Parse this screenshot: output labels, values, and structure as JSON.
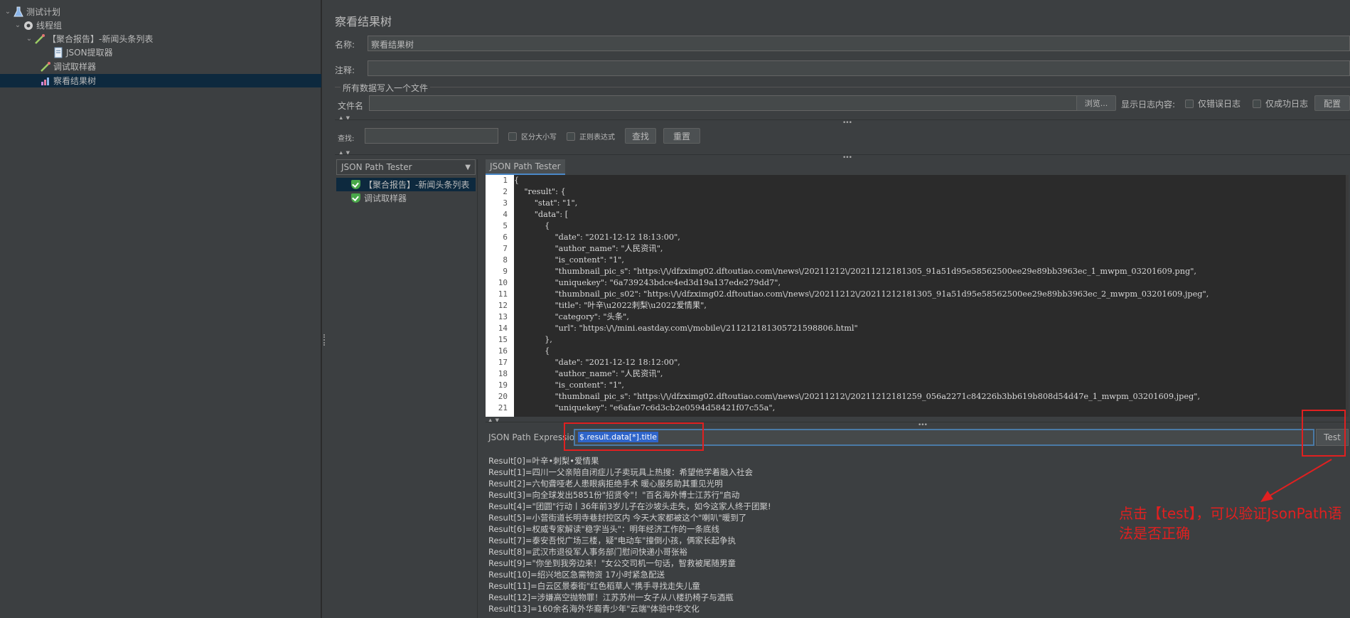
{
  "tree": {
    "items": [
      {
        "label": "测试计划",
        "icon": "flask-icon"
      },
      {
        "label": "线程组",
        "icon": "gear-icon"
      },
      {
        "label": "【聚合报告】-新闻头条列表",
        "icon": "pipette-icon"
      },
      {
        "label": "JSON提取器",
        "icon": "document-icon"
      },
      {
        "label": "调试取样器",
        "icon": "pipette-icon"
      },
      {
        "label": "察看结果树",
        "icon": "chart-icon"
      }
    ]
  },
  "panel": {
    "title": "察看结果树",
    "name_label": "名称:",
    "name_value": "察看结果树",
    "comment_label": "注释:",
    "comment_value": "",
    "file_group_label": "所有数据写入一个文件",
    "file_label": "文件名",
    "file_value": "",
    "browse_label": "浏览...",
    "log_label": "显示日志内容:",
    "errors_only_label": "仅错误日志",
    "success_only_label": "仅成功日志",
    "config_label": "配置"
  },
  "search": {
    "label": "查找:",
    "value": "",
    "case_label": "区分大小写",
    "regex_label": "正则表达式",
    "find_button": "查找",
    "reset_button": "重置"
  },
  "results_tree": {
    "renderer": "JSON Path Tester",
    "samples": [
      {
        "label": "【聚合报告】-新闻头条列表",
        "status": "success"
      },
      {
        "label": "调试取样器",
        "status": "success"
      }
    ]
  },
  "json_tab": {
    "label": "JSON Path Tester",
    "lines": [
      "{",
      "    \"result\": {",
      "        \"stat\": \"1\",",
      "        \"data\": [",
      "            {",
      "                \"date\": \"2021-12-12 18:13:00\",",
      "                \"author_name\": \"人民资讯\",",
      "                \"is_content\": \"1\",",
      "                \"thumbnail_pic_s\": \"https:\\/\\/dfzximg02.dftoutiao.com\\/news\\/20211212\\/20211212181305_91a51d95e58562500ee29e89bb3963ec_1_mwpm_03201609.png\",",
      "                \"uniquekey\": \"6a739243bdce4ed3d19a137ede279dd7\",",
      "                \"thumbnail_pic_s02\": \"https:\\/\\/dfzximg02.dftoutiao.com\\/news\\/20211212\\/20211212181305_91a51d95e58562500ee29e89bb3963ec_2_mwpm_03201609.jpeg\",",
      "                \"title\": \"叶辛\\u2022刺梨\\u2022爱情果\",",
      "                \"category\": \"头条\",",
      "                \"url\": \"https:\\/\\/mini.eastday.com\\/mobile\\/211212181305721598806.html\"",
      "            },",
      "            {",
      "                \"date\": \"2021-12-12 18:12:00\",",
      "                \"author_name\": \"人民资讯\",",
      "                \"is_content\": \"1\",",
      "                \"thumbnail_pic_s\": \"https:\\/\\/dfzximg02.dftoutiao.com\\/news\\/20211212\\/20211212181259_056a2271c84226b3bb619b808d54d47e_1_mwpm_03201609.jpeg\",",
      "                \"uniquekey\": \"e6afae7c6d3cb2e0594d58421f07c55a\","
    ]
  },
  "expression": {
    "label": "JSON Path Expression",
    "value": "$.result.data[*].title",
    "test_button": "Test"
  },
  "results": [
    "Result[0]=叶辛•刺梨•爱情果",
    "Result[1]=四川一父亲陪自闭症儿子卖玩具上热搜：希望他学着融入社会",
    "Result[2]=六旬聋哑老人患眼病拒绝手术 暖心服务助其重见光明",
    "Result[3]=向全球发出5851份\"招贤令\"！\"百名海外博士江苏行\"启动",
    "Result[4]=\"团圆\"行动丨36年前3岁儿子在沙坡头走失，如今这家人终于团聚!",
    "Result[5]=小营街道长明寺巷封控区内 今天大家都被这个\"喇叭\"暖到了",
    "Result[6]=权威专家解读\"稳字当头\"：明年经济工作的一条底线",
    "Result[7]=泰安吾悦广场三楼，疑\"电动车\"撞倒小孩，俩家长起争执",
    "Result[8]=武汉市退役军人事务部门慰问快递小哥张裕",
    "Result[9]=\"你坐到我旁边来！\"女公交司机一句话，智救被尾随男童",
    "Result[10]=绍兴地区急需物资 17小时紧急配送",
    "Result[11]=白云区景泰街\"红色稻草人\"携手寻找走失儿童",
    "Result[12]=涉嫌高空抛物罪！江苏苏州一女子从八楼扔椅子与酒瓶",
    "Result[13]=160余名海外华裔青少年\"云端\"体验中华文化"
  ],
  "annotation": {
    "text": "点击【test】，可以验证JsonPath语法是否正确",
    "color": "#e02020"
  }
}
